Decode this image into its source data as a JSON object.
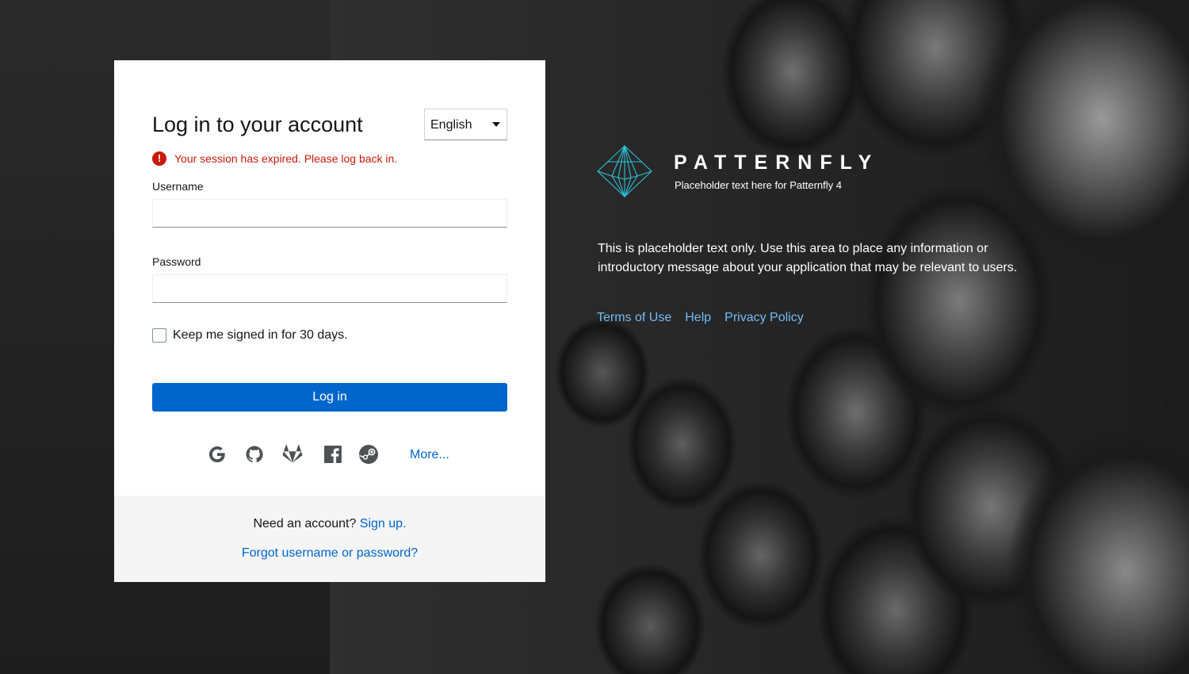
{
  "login": {
    "title": "Log in to your account",
    "language": "English",
    "error": "Your session has expired. Please log back in.",
    "username_label": "Username",
    "username_value": "",
    "password_label": "Password",
    "password_value": "",
    "remember_label": "Keep me signed in for 30 days.",
    "remember_checked": false,
    "submit_label": "Log in",
    "social_providers": [
      "google-icon",
      "github-icon",
      "gitlab-icon",
      "facebook-icon",
      "steam-icon"
    ],
    "more_label": "More..."
  },
  "footer": {
    "need_account": "Need an account?",
    "signup_label": "Sign up.",
    "forgot_label": "Forgot username or password?"
  },
  "brand": {
    "name": "PATTERNFLY",
    "tagline": "Placeholder text here for Patternfly 4",
    "intro": "This is placeholder text only. Use this area to place any information or introductory message about your application that may be relevant to users.",
    "links": [
      "Terms of Use",
      "Help",
      "Privacy Policy"
    ]
  },
  "colors": {
    "primary": "#0066cc",
    "danger": "#c9190b",
    "link_dark_bg": "#73bcf7",
    "logo_accent": "#2bc2d8"
  }
}
